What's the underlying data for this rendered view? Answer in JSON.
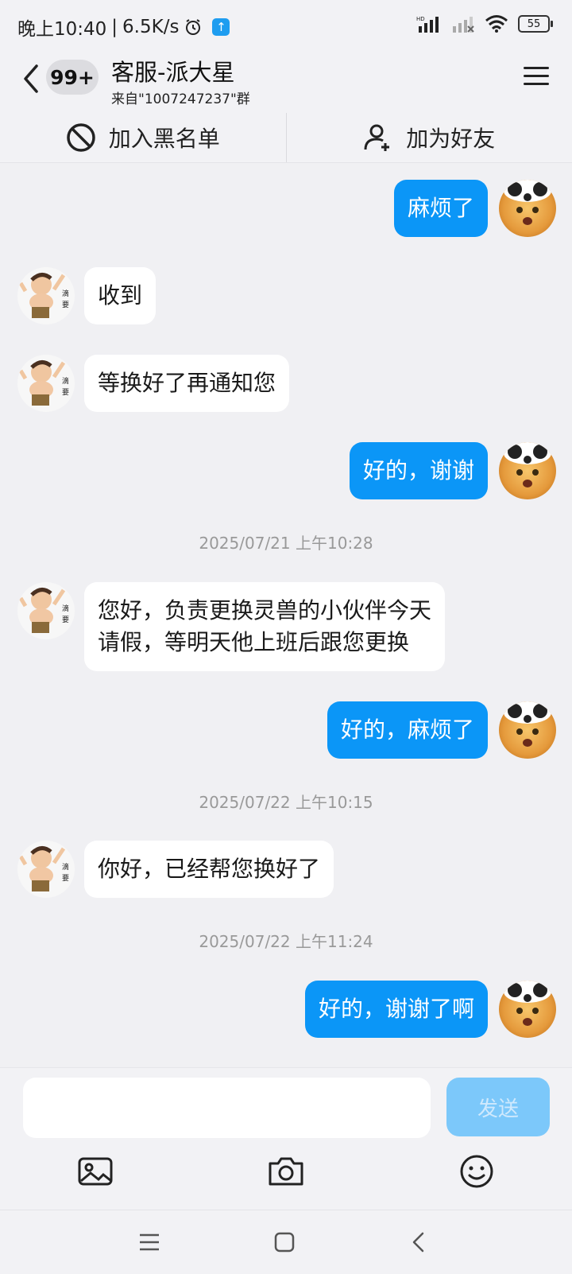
{
  "status": {
    "time": "晚上10:40",
    "speed": "6.5K/s",
    "battery": "55"
  },
  "header": {
    "unread": "99+",
    "title": "客服-派大星",
    "subtitle": "来自\"1007247237\"群"
  },
  "actions": {
    "block": "加入黑名单",
    "add_friend": "加为好友"
  },
  "messages": [
    {
      "side": "out",
      "text": "麻烦了"
    },
    {
      "side": "in",
      "text": "收到"
    },
    {
      "side": "in",
      "text": "等换好了再通知您"
    },
    {
      "side": "out",
      "text": "好的，谢谢"
    },
    {
      "side": "in",
      "line1": "您好，负责更换灵兽的小伙伴今天",
      "line2": "请假，等明天他上班后跟您更换"
    },
    {
      "side": "out",
      "text": "好的，麻烦了"
    },
    {
      "side": "in",
      "text": "你好，已经帮您换好了"
    },
    {
      "side": "out",
      "text": "好的，谢谢了啊"
    }
  ],
  "timestamps": [
    "2025/07/21 上午10:28",
    "2025/07/22 上午10:15",
    "2025/07/22 上午11:24"
  ],
  "input": {
    "placeholder": "",
    "send": "发送"
  },
  "colors": {
    "outgoing_bubble": "#0b96f7",
    "incoming_bubble": "#ffffff",
    "background": "#f0f0f3",
    "send_disabled": "#7cc8fa"
  },
  "icons": {
    "image": "image-icon",
    "camera": "camera-icon",
    "emoji": "emoji-icon",
    "menu": "menu-icon",
    "back": "back-icon",
    "block": "block-icon",
    "add_friend": "add-friend-icon"
  }
}
